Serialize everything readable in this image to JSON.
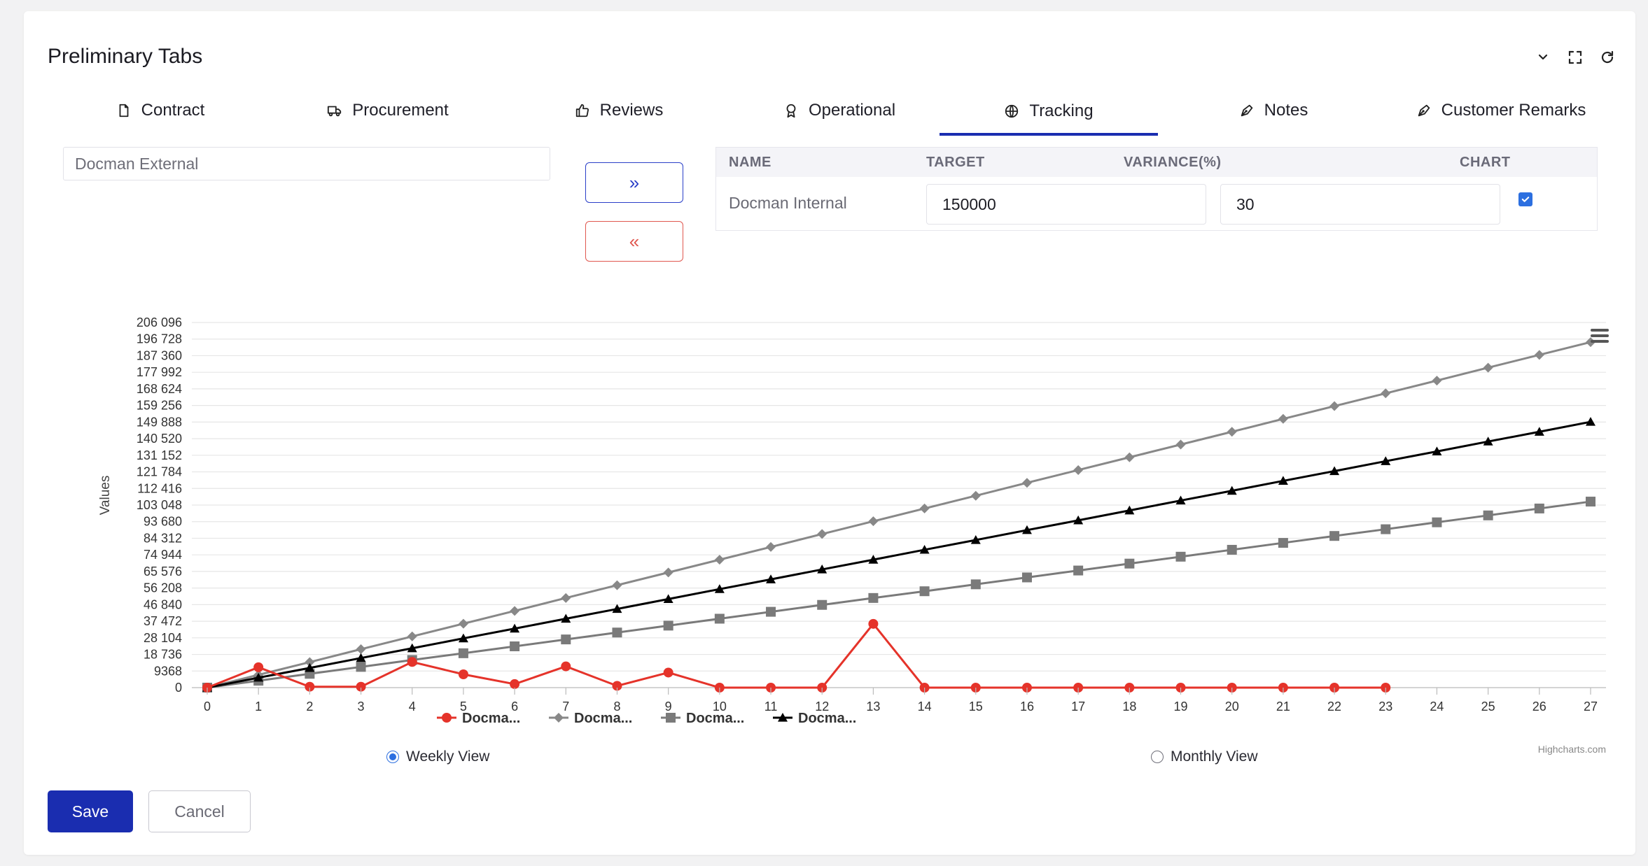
{
  "header": {
    "title": "Preliminary Tabs"
  },
  "tabs": [
    {
      "label": "Contract",
      "icon": "file-icon"
    },
    {
      "label": "Procurement",
      "icon": "truck-icon"
    },
    {
      "label": "Reviews",
      "icon": "thumbs-up-icon"
    },
    {
      "label": "Operational",
      "icon": "award-icon"
    },
    {
      "label": "Tracking",
      "icon": "globe-icon",
      "active": true
    },
    {
      "label": "Notes",
      "icon": "pen-tool-icon"
    },
    {
      "label": "Customer Remarks",
      "icon": "pen-tool-icon"
    }
  ],
  "available": {
    "item": "Docman External"
  },
  "move": {
    "right": "»",
    "left": "«"
  },
  "table": {
    "headers": {
      "name": "NAME",
      "target": "TARGET",
      "variance": "VARIANCE(%)",
      "chart": "CHART"
    },
    "rows": [
      {
        "name": "Docman Internal",
        "target": "150000",
        "variance": "30",
        "chart_checked": true
      }
    ]
  },
  "views": {
    "weekly": "Weekly View",
    "monthly": "Monthly View",
    "selected": "weekly"
  },
  "actions": {
    "save": "Save",
    "cancel": "Cancel"
  },
  "colors": {
    "accent": "#1a2db0",
    "series_red": "#e5332a",
    "series_gray": "#888888",
    "series_darkgray": "#7a7a7a",
    "series_black": "#000000"
  },
  "chart_data": {
    "type": "line",
    "ylabel": "Values",
    "xlabel": "",
    "credit": "Highcharts.com",
    "x": [
      0,
      1,
      2,
      3,
      4,
      5,
      6,
      7,
      8,
      9,
      10,
      11,
      12,
      13,
      14,
      15,
      16,
      17,
      18,
      19,
      20,
      21,
      22,
      23,
      24,
      25,
      26,
      27
    ],
    "ylim": [
      0,
      206096
    ],
    "yticks": [
      "0",
      "9368",
      "18 736",
      "28 104",
      "37 472",
      "46 840",
      "56 208",
      "65 576",
      "74 944",
      "84 312",
      "93 680",
      "103 048",
      "112 416",
      "121 784",
      "131 152",
      "140 520",
      "149 888",
      "159 256",
      "168 624",
      "177 992",
      "187 360",
      "196 728",
      "206 096"
    ],
    "series": [
      {
        "name": "Docma...",
        "marker": "circle",
        "color": "#e5332a",
        "values": [
          0,
          11500,
          500,
          500,
          14500,
          7500,
          2000,
          12000,
          1000,
          8500,
          0,
          0,
          0,
          36000,
          0,
          0,
          0,
          0,
          0,
          0,
          0,
          0,
          0,
          0
        ]
      },
      {
        "name": "Docma...",
        "marker": "diamond",
        "color": "#888888",
        "values": [
          0,
          7200,
          14400,
          21700,
          28900,
          36100,
          43300,
          50600,
          57800,
          65000,
          72200,
          79400,
          86700,
          93900,
          101100,
          108300,
          115600,
          122800,
          130000,
          137200,
          144400,
          151700,
          158900,
          166100,
          173300,
          180600,
          187800,
          195000
        ]
      },
      {
        "name": "Docma...",
        "marker": "square",
        "color": "#7a7a7a",
        "values": [
          0,
          3900,
          7800,
          11700,
          15600,
          19400,
          23300,
          27200,
          31100,
          35000,
          38900,
          42800,
          46700,
          50600,
          54400,
          58300,
          62200,
          66100,
          70000,
          73900,
          77800,
          81700,
          85600,
          89400,
          93300,
          97200,
          101100,
          105000
        ]
      },
      {
        "name": "Docma...",
        "marker": "triangle",
        "color": "#000000",
        "values": [
          0,
          5600,
          11100,
          16700,
          22200,
          27800,
          33300,
          38900,
          44400,
          50000,
          55600,
          61100,
          66700,
          72200,
          77800,
          83300,
          88900,
          94400,
          100000,
          105600,
          111100,
          116700,
          122200,
          127800,
          133300,
          138900,
          144400,
          150000
        ]
      }
    ]
  }
}
